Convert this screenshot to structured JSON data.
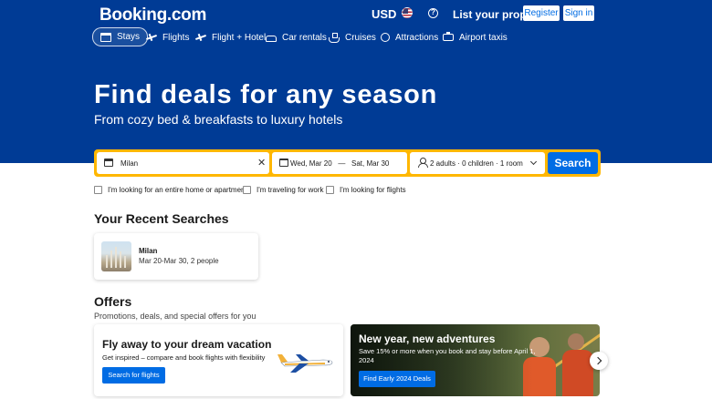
{
  "header": {
    "logo": "Booking.com",
    "currency": "USD",
    "list_property": "List your property",
    "register": "Register",
    "sign_in": "Sign in"
  },
  "nav": {
    "items": [
      {
        "label": "Stays",
        "icon": "bed-icon",
        "active": true
      },
      {
        "label": "Flights",
        "icon": "plane-icon"
      },
      {
        "label": "Flight + Hotel",
        "icon": "flight-hotel-icon"
      },
      {
        "label": "Car rentals",
        "icon": "car-icon"
      },
      {
        "label": "Cruises",
        "icon": "ship-icon"
      },
      {
        "label": "Attractions",
        "icon": "attractions-icon"
      },
      {
        "label": "Airport taxis",
        "icon": "taxi-icon"
      }
    ]
  },
  "hero": {
    "title": "Find deals for any season",
    "subtitle": "From cozy bed & breakfasts to luxury hotels"
  },
  "search": {
    "destination": "Milan",
    "check_in": "Wed, Mar 20",
    "separator": "—",
    "check_out": "Sat, Mar 30",
    "guests": "2 adults · 0 children · 1 room",
    "button": "Search"
  },
  "options": {
    "entire_home": "I'm looking for an entire home or apartment",
    "work": "I'm traveling for work",
    "flights": "I'm looking for flights"
  },
  "recent": {
    "heading": "Your Recent Searches",
    "items": [
      {
        "city": "Milan",
        "details": "Mar 20-Mar 30, 2 people"
      }
    ]
  },
  "offers": {
    "heading": "Offers",
    "subtitle": "Promotions, deals, and special offers for you",
    "cards": [
      {
        "title": "Fly away to your dream vacation",
        "body": "Get inspired – compare and book flights with flexibility",
        "button": "Search for flights"
      },
      {
        "title": "New year, new adventures",
        "body": "Save 15% or more when you book and stay before April 1, 2024",
        "button": "Find Early 2024 Deals"
      }
    ]
  },
  "colors": {
    "brand_blue": "#003b95",
    "accent_blue": "#006ce4",
    "search_border": "#ffb700"
  }
}
